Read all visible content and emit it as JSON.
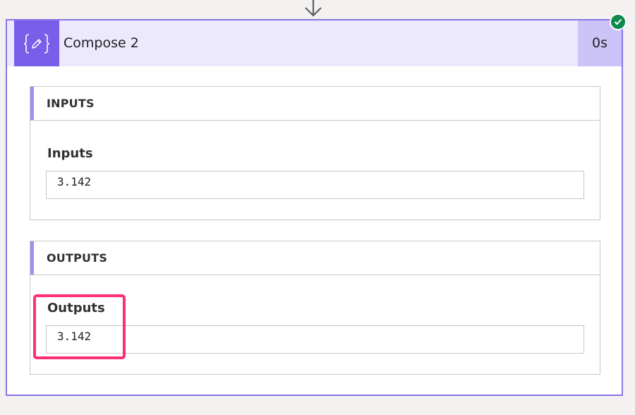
{
  "action": {
    "title": "Compose 2",
    "duration": "0s",
    "status": "succeeded",
    "icon": "compose-braces-pencil-icon"
  },
  "inputs": {
    "section_title": "INPUTS",
    "field_label": "Inputs",
    "field_value": "3.142"
  },
  "outputs": {
    "section_title": "OUTPUTS",
    "field_label": "Outputs",
    "field_value": "3.142"
  },
  "colors": {
    "accent": "#785ee8",
    "header_bg": "#ece9fd",
    "duration_bg": "#ccc3f9",
    "success": "#0e8a4b",
    "highlight": "#ff2e72"
  }
}
